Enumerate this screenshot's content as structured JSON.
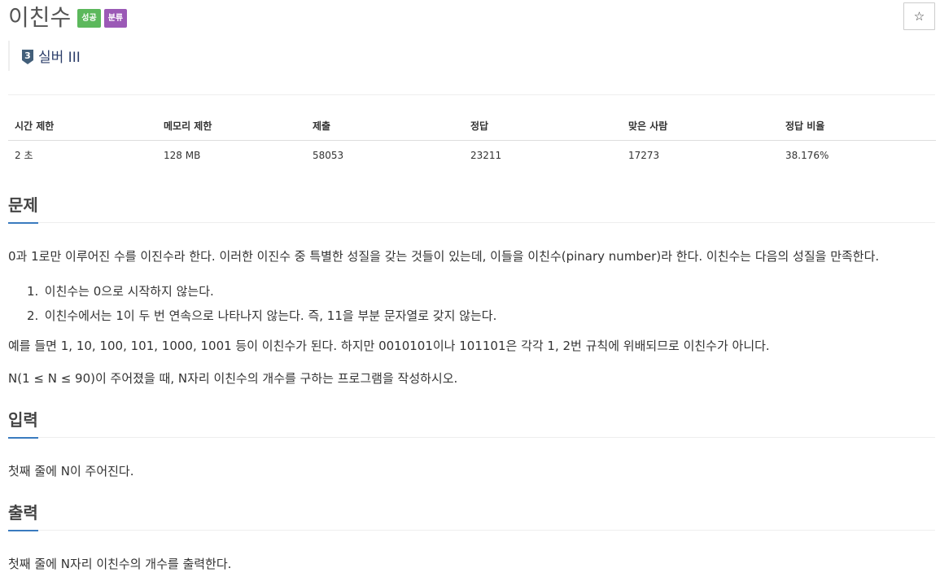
{
  "problem": {
    "title": "이친수",
    "badges": {
      "success": "성공",
      "category": "분류"
    },
    "star_icon": "☆",
    "tier": {
      "label": "실버 III",
      "icon_number": "3",
      "color": "#435f7a"
    }
  },
  "info_table": {
    "headers": [
      "시간 제한",
      "메모리 제한",
      "제출",
      "정답",
      "맞은 사람",
      "정답 비율"
    ],
    "values": [
      "2 초",
      "128 MB",
      "58053",
      "23211",
      "17273",
      "38.176%"
    ]
  },
  "sections": {
    "description": {
      "title": "문제",
      "intro": "0과 1로만 이루어진 수를 이진수라 한다. 이러한 이진수 중 특별한 성질을 갖는 것들이 있는데, 이들을 이친수(pinary number)라 한다. 이친수는 다음의 성질을 만족한다.",
      "rules": [
        {
          "num": "1.",
          "text": "이친수는 0으로 시작하지 않는다."
        },
        {
          "num": "2.",
          "text": "이친수에서는 1이 두 번 연속으로 나타나지 않는다. 즉, 11을 부분 문자열로 갖지 않는다."
        }
      ],
      "example": "예를 들면 1, 10, 100, 101, 1000, 1001 등이 이친수가 된다. 하지만 0010101이나 101101은 각각 1, 2번 규칙에 위배되므로 이친수가 아니다.",
      "task": "N(1 ≤ N ≤ 90)이 주어졌을 때, N자리 이친수의 개수를 구하는 프로그램을 작성하시오."
    },
    "input": {
      "title": "입력",
      "text": "첫째 줄에 N이 주어진다."
    },
    "output": {
      "title": "출력",
      "text": "첫째 줄에 N자리 이친수의 개수를 출력한다."
    }
  },
  "colors": {
    "success": "#5cb85c",
    "category": "#9b59b6",
    "section_underline": "#3a7bbf"
  }
}
